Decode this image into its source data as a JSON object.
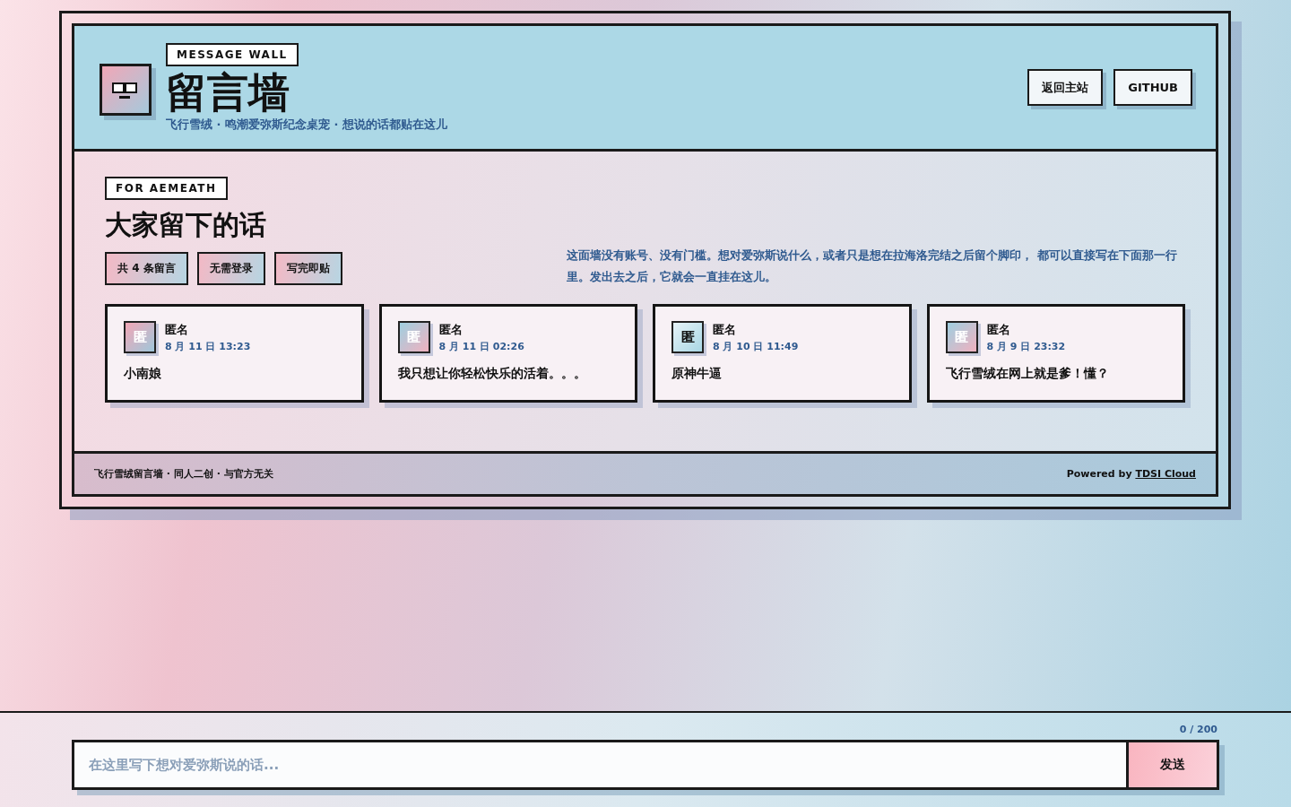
{
  "header": {
    "tag": "MESSAGE WALL",
    "title": "留言墙",
    "subtitle": "飞行雪绒 · 鸣潮爱弥斯纪念桌宠 · 想说的话都贴在这儿",
    "buttons": [
      "返回主站",
      "GITHUB"
    ]
  },
  "wall": {
    "tag": "FOR AEMEATH",
    "title": "大家留下的话",
    "chips": [
      "共 4 条留言",
      "无需登录",
      "写完即贴"
    ],
    "description": "这面墙没有账号、没有门槛。想对爱弥斯说什么，或者只是想在拉海洛完结之后留个脚印， 都可以直接写在下面那一行里。发出去之后，它就会一直挂在这儿。",
    "messages": [
      {
        "avatar": "匿",
        "kind": "pink-blue",
        "author": "匿名",
        "time": "8 月 11 日 13:23",
        "text": "小南娘"
      },
      {
        "avatar": "匿",
        "kind": "blue-pink",
        "author": "匿名",
        "time": "8 月 11 日 02:26",
        "text": "我只想让你轻松快乐的活着。。。"
      },
      {
        "avatar": "匿",
        "kind": "light",
        "author": "匿名",
        "time": "8 月 10 日 11:49",
        "text": "原神牛逼"
      },
      {
        "avatar": "匿",
        "kind": "blue-pink",
        "author": "匿名",
        "time": "8 月 9 日 23:32",
        "text": "飞行雪绒在网上就是爹！懂？"
      }
    ]
  },
  "footer": {
    "left": "飞行雪绒留言墙 · 同人二创 · 与官方无关",
    "powered": "Powered by",
    "link": "TDSI Cloud"
  },
  "composer": {
    "counter": "0 / 200",
    "placeholder": "在这里写下想对爱弥斯说的话...",
    "send": "发送"
  }
}
